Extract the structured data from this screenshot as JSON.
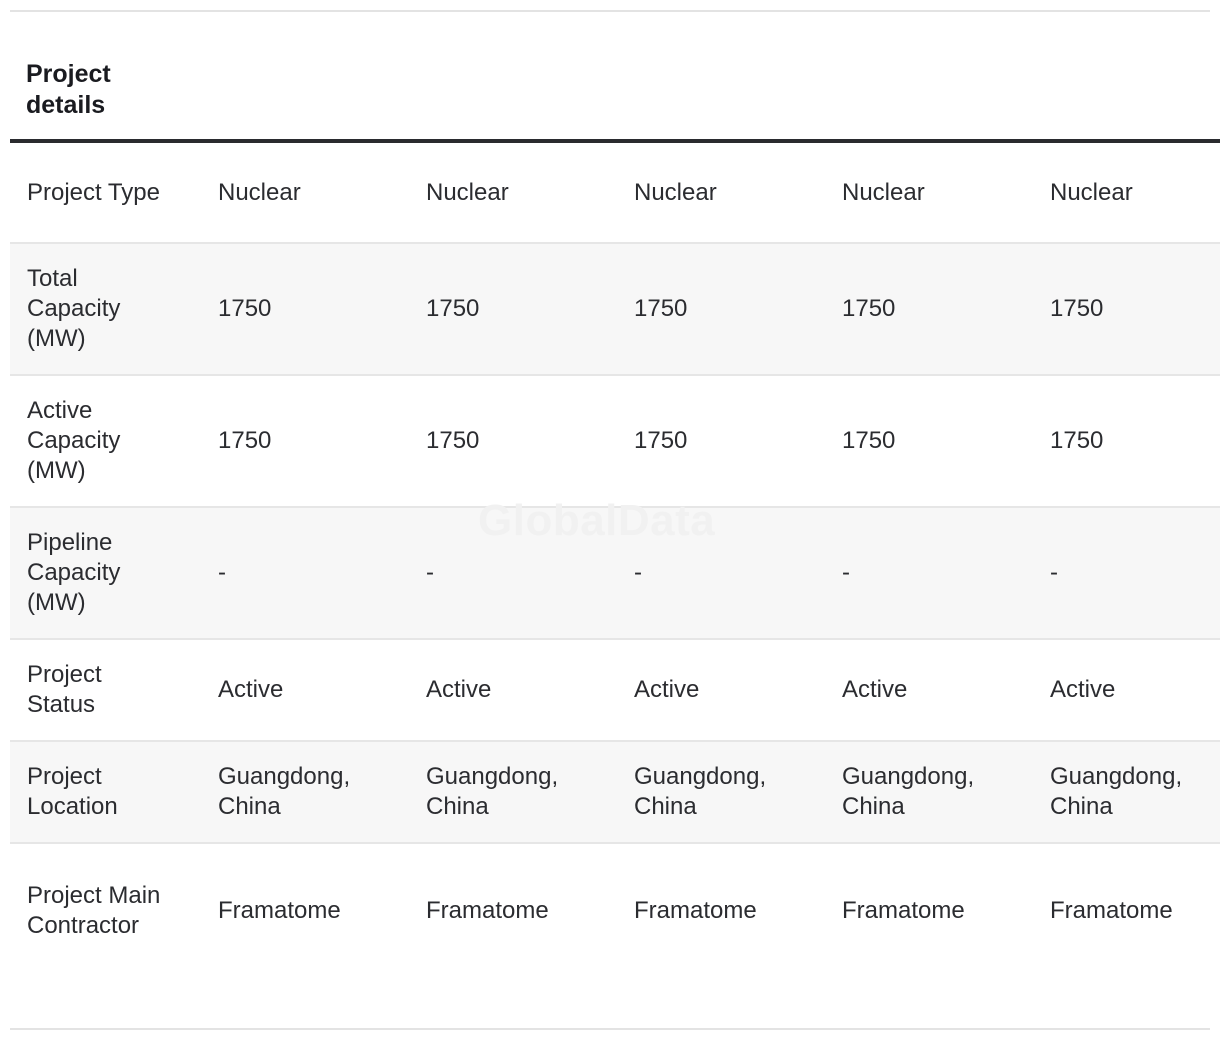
{
  "table": {
    "title": "Project details",
    "rows": [
      {
        "label": "Project Type",
        "values": [
          "Nuclear",
          "Nuclear",
          "Nuclear",
          "Nuclear",
          "Nuclear"
        ]
      },
      {
        "label": "Total Capacity (MW)",
        "values": [
          "1750",
          "1750",
          "1750",
          "1750",
          "1750"
        ]
      },
      {
        "label": "Active Capacity (MW)",
        "values": [
          "1750",
          "1750",
          "1750",
          "1750",
          "1750"
        ]
      },
      {
        "label": "Pipeline Capacity (MW)",
        "values": [
          "-",
          "-",
          "-",
          "-",
          "-"
        ]
      },
      {
        "label": "Project Status",
        "values": [
          "Active",
          "Active",
          "Active",
          "Active",
          "Active"
        ]
      },
      {
        "label": "Project Location",
        "values": [
          "Guangdong, China",
          "Guangdong, China",
          "Guangdong, China",
          "Guangdong, China",
          "Guangdong, China"
        ]
      },
      {
        "label": "Project Main Contractor",
        "values": [
          "Framatome",
          "Framatome",
          "Framatome",
          "Framatome",
          "Framatome"
        ]
      }
    ]
  },
  "watermark": "GlobalData"
}
